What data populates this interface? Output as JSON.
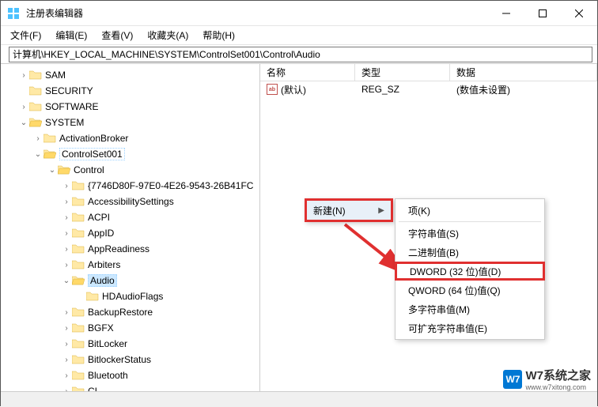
{
  "window": {
    "title": "注册表编辑器"
  },
  "menu": {
    "items": [
      "文件(F)",
      "编辑(E)",
      "查看(V)",
      "收藏夹(A)",
      "帮助(H)"
    ]
  },
  "address": {
    "label": "计算机",
    "path": "计算机\\HKEY_LOCAL_MACHINE\\SYSTEM\\ControlSet001\\Control\\Audio"
  },
  "tree": [
    {
      "indent": 1,
      "expander": ">",
      "label": "SAM"
    },
    {
      "indent": 1,
      "expander": "",
      "label": "SECURITY"
    },
    {
      "indent": 1,
      "expander": ">",
      "label": "SOFTWARE"
    },
    {
      "indent": 1,
      "expander": "v",
      "label": "SYSTEM"
    },
    {
      "indent": 2,
      "expander": ">",
      "label": "ActivationBroker"
    },
    {
      "indent": 2,
      "expander": "v",
      "label": "ControlSet001",
      "hovered": true
    },
    {
      "indent": 3,
      "expander": "v",
      "label": "Control"
    },
    {
      "indent": 4,
      "expander": ">",
      "label": "{7746D80F-97E0-4E26-9543-26B41FC"
    },
    {
      "indent": 4,
      "expander": ">",
      "label": "AccessibilitySettings"
    },
    {
      "indent": 4,
      "expander": ">",
      "label": "ACPI"
    },
    {
      "indent": 4,
      "expander": ">",
      "label": "AppID"
    },
    {
      "indent": 4,
      "expander": ">",
      "label": "AppReadiness"
    },
    {
      "indent": 4,
      "expander": ">",
      "label": "Arbiters"
    },
    {
      "indent": 4,
      "expander": "v",
      "label": "Audio",
      "selected": true
    },
    {
      "indent": 5,
      "expander": "",
      "label": "HDAudioFlags"
    },
    {
      "indent": 4,
      "expander": ">",
      "label": "BackupRestore"
    },
    {
      "indent": 4,
      "expander": ">",
      "label": "BGFX"
    },
    {
      "indent": 4,
      "expander": ">",
      "label": "BitLocker"
    },
    {
      "indent": 4,
      "expander": ">",
      "label": "BitlockerStatus"
    },
    {
      "indent": 4,
      "expander": ">",
      "label": "Bluetooth"
    },
    {
      "indent": 4,
      "expander": ">",
      "label": "CI"
    }
  ],
  "columns": {
    "name": "名称",
    "type": "类型",
    "data": "数据"
  },
  "values": [
    {
      "name": "(默认)",
      "type": "REG_SZ",
      "data": "(数值未设置)"
    }
  ],
  "context_primary": {
    "new_label": "新建(N)"
  },
  "context_secondary": [
    {
      "label": "项(K)"
    },
    {
      "label": "字符串值(S)"
    },
    {
      "label": "二进制值(B)"
    },
    {
      "label": "DWORD (32 位)值(D)",
      "highlighted": true
    },
    {
      "label": "QWORD (64 位)值(Q)"
    },
    {
      "label": "多字符串值(M)"
    },
    {
      "label": "可扩充字符串值(E)"
    }
  ],
  "watermark": {
    "badge": "W7",
    "text": "W7系统之家",
    "url": "www.w7xitong.com"
  }
}
